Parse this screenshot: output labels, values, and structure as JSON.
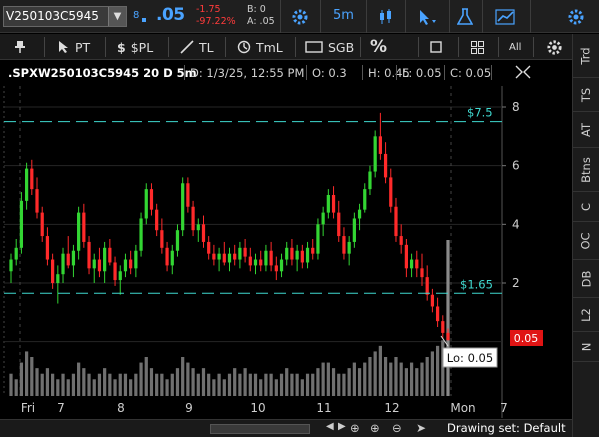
{
  "topbar": {
    "symbol": "V250103C5945",
    "price": ".05",
    "change": "-1.75",
    "change_pct": "-97.22%",
    "bid": "B: 0",
    "ask": "A: .05",
    "timeframe": "5m"
  },
  "drawbar": {
    "pt_label": "PT",
    "pl_label": "$PL",
    "tl_label": "TL",
    "tml_label": "TmL",
    "sgb_label": "SGB",
    "all_label": "All"
  },
  "chart_header": {
    "symbol": ".SPXW250103C5945 20 D 5m",
    "date": "D: 1/3/25, 12:55 PM",
    "open": "O: 0.3",
    "high": "H: 0.45",
    "low": "L: 0.05",
    "close": "C: 0.05"
  },
  "right_tabs": [
    "Trd",
    "TS",
    "AT",
    "Btns",
    "C",
    "OC",
    "DB",
    "L2",
    "N"
  ],
  "price_levels": {
    "upper_label": "$7.5",
    "lower_label": "$1.65",
    "last_price_label": "0.05",
    "tooltip": "Lo: 0.05"
  },
  "colors": {
    "up": "#33d633",
    "down": "#ff2a2a",
    "accent": "#4aa3ff",
    "price_line": "#3fd9d0",
    "volume": "#707070"
  },
  "bottombar": {
    "drawing_set": "Drawing set: Default"
  },
  "chart_data": {
    "type": "candlestick",
    "x_labels": [
      "Fri",
      "7",
      "8",
      "9",
      "10",
      "11",
      "12",
      "Mon",
      "7"
    ],
    "y_ticks": [
      2,
      4,
      6,
      8
    ],
    "ylim": [
      0,
      8.5
    ],
    "horizontal_levels": [
      7.5,
      1.65
    ],
    "last_price": 0.05,
    "candles": [
      [
        2.4,
        3.0,
        2.0,
        2.8
      ],
      [
        2.8,
        3.5,
        2.6,
        3.2
      ],
      [
        3.2,
        5.1,
        3.0,
        4.8
      ],
      [
        4.8,
        6.1,
        4.5,
        5.9
      ],
      [
        5.9,
        6.2,
        5.0,
        5.2
      ],
      [
        5.2,
        5.6,
        4.2,
        4.4
      ],
      [
        4.4,
        4.6,
        3.4,
        3.6
      ],
      [
        3.6,
        3.9,
        2.6,
        2.8
      ],
      [
        2.8,
        3.0,
        1.8,
        2.0
      ],
      [
        2.0,
        2.6,
        1.3,
        2.3
      ],
      [
        2.3,
        3.2,
        2.0,
        3.0
      ],
      [
        3.0,
        3.6,
        2.5,
        2.6
      ],
      [
        2.6,
        3.3,
        2.2,
        3.1
      ],
      [
        3.1,
        4.6,
        2.8,
        4.4
      ],
      [
        4.4,
        4.7,
        3.2,
        3.4
      ],
      [
        3.4,
        3.6,
        2.3,
        2.5
      ],
      [
        2.5,
        3.0,
        2.0,
        2.8
      ],
      [
        2.8,
        3.2,
        2.2,
        2.4
      ],
      [
        2.4,
        3.4,
        2.0,
        3.2
      ],
      [
        3.2,
        3.5,
        2.6,
        2.7
      ],
      [
        2.7,
        2.9,
        1.9,
        2.1
      ],
      [
        2.1,
        2.6,
        1.6,
        2.4
      ],
      [
        2.4,
        3.0,
        2.2,
        2.8
      ],
      [
        2.8,
        3.1,
        2.3,
        2.5
      ],
      [
        2.5,
        3.3,
        2.2,
        3.1
      ],
      [
        3.1,
        4.4,
        2.9,
        4.2
      ],
      [
        4.2,
        5.4,
        4.0,
        5.2
      ],
      [
        5.2,
        5.4,
        4.3,
        4.5
      ],
      [
        4.5,
        4.7,
        3.6,
        3.8
      ],
      [
        3.8,
        4.2,
        3.0,
        3.2
      ],
      [
        3.2,
        3.4,
        2.4,
        2.6
      ],
      [
        2.6,
        3.3,
        2.3,
        3.1
      ],
      [
        3.1,
        4.0,
        2.9,
        3.8
      ],
      [
        3.8,
        5.6,
        3.6,
        5.4
      ],
      [
        5.4,
        5.6,
        4.4,
        4.6
      ],
      [
        4.6,
        4.8,
        3.6,
        3.8
      ],
      [
        3.8,
        4.2,
        3.4,
        4.0
      ],
      [
        4.0,
        4.3,
        3.2,
        3.4
      ],
      [
        3.4,
        3.6,
        2.8,
        3.0
      ],
      [
        3.0,
        3.3,
        2.6,
        2.8
      ],
      [
        2.8,
        3.2,
        2.4,
        3.0
      ],
      [
        3.0,
        3.4,
        2.6,
        2.7
      ],
      [
        2.7,
        3.2,
        2.4,
        3.0
      ],
      [
        3.0,
        3.3,
        2.6,
        2.8
      ],
      [
        2.8,
        3.4,
        2.5,
        3.2
      ],
      [
        3.2,
        3.5,
        2.7,
        2.9
      ],
      [
        2.9,
        3.2,
        2.4,
        2.6
      ],
      [
        2.6,
        3.0,
        2.3,
        2.8
      ],
      [
        2.8,
        3.1,
        2.4,
        2.6
      ],
      [
        2.6,
        3.3,
        2.4,
        3.1
      ],
      [
        3.1,
        3.4,
        2.4,
        2.6
      ],
      [
        2.6,
        2.9,
        2.1,
        2.4
      ],
      [
        2.4,
        3.0,
        2.2,
        2.8
      ],
      [
        2.8,
        3.4,
        2.6,
        3.2
      ],
      [
        3.2,
        3.5,
        2.6,
        2.8
      ],
      [
        2.8,
        3.3,
        2.4,
        3.1
      ],
      [
        3.1,
        3.3,
        2.5,
        2.7
      ],
      [
        2.7,
        3.4,
        2.5,
        3.2
      ],
      [
        3.2,
        3.5,
        2.8,
        3.0
      ],
      [
        3.0,
        4.2,
        2.8,
        4.0
      ],
      [
        4.0,
        4.6,
        3.6,
        4.4
      ],
      [
        4.4,
        5.2,
        4.2,
        5.0
      ],
      [
        5.0,
        5.3,
        4.2,
        4.4
      ],
      [
        4.4,
        4.8,
        3.4,
        3.6
      ],
      [
        3.6,
        3.9,
        2.8,
        3.0
      ],
      [
        3.0,
        3.6,
        2.6,
        3.4
      ],
      [
        3.4,
        4.4,
        3.2,
        4.2
      ],
      [
        4.2,
        4.7,
        3.8,
        4.5
      ],
      [
        4.5,
        5.4,
        4.4,
        5.2
      ],
      [
        5.2,
        6.0,
        5.0,
        5.8
      ],
      [
        5.8,
        7.2,
        5.6,
        7.0
      ],
      [
        7.0,
        7.8,
        6.2,
        6.4
      ],
      [
        6.4,
        6.8,
        5.4,
        5.6
      ],
      [
        5.6,
        5.9,
        4.4,
        4.6
      ],
      [
        4.6,
        4.9,
        3.4,
        3.6
      ],
      [
        3.6,
        4.0,
        3.0,
        3.3
      ],
      [
        3.3,
        3.5,
        2.2,
        2.5
      ],
      [
        2.5,
        3.0,
        2.2,
        2.8
      ],
      [
        2.8,
        3.1,
        2.2,
        2.5
      ],
      [
        2.5,
        3.0,
        1.9,
        2.2
      ],
      [
        2.2,
        2.6,
        1.4,
        1.6
      ],
      [
        1.6,
        1.8,
        1.0,
        1.2
      ],
      [
        1.2,
        1.5,
        0.5,
        0.7
      ],
      [
        0.7,
        0.9,
        0.1,
        0.3
      ],
      [
        0.3,
        0.45,
        0.05,
        0.05
      ]
    ],
    "volume": [
      4,
      3,
      6,
      8,
      7,
      5,
      4,
      5,
      4,
      3,
      4,
      3,
      4,
      6,
      5,
      4,
      3,
      4,
      5,
      4,
      3,
      4,
      4,
      3,
      4,
      6,
      7,
      5,
      4,
      4,
      3,
      4,
      5,
      7,
      6,
      5,
      4,
      5,
      4,
      3,
      4,
      3,
      4,
      5,
      4,
      5,
      4,
      4,
      3,
      4,
      4,
      3,
      4,
      5,
      4,
      4,
      3,
      4,
      4,
      5,
      6,
      6,
      5,
      4,
      4,
      5,
      6,
      5,
      6,
      7,
      8,
      9,
      7,
      6,
      7,
      6,
      5,
      6,
      5,
      6,
      7,
      8,
      9,
      10,
      28
    ]
  }
}
